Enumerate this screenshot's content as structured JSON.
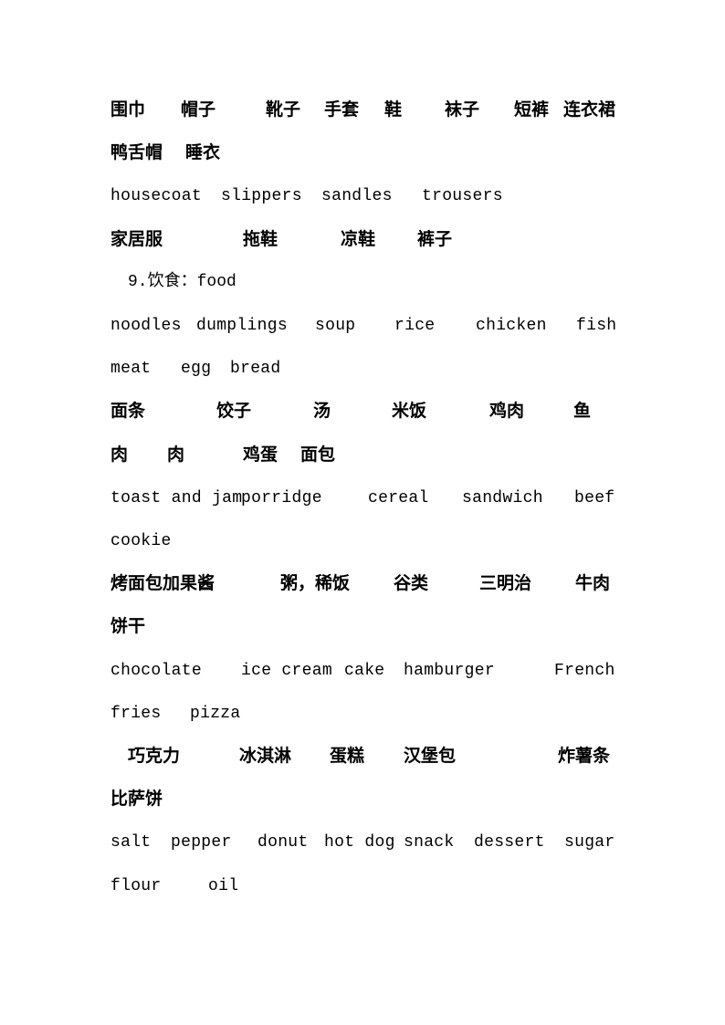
{
  "document": {
    "clothing_cn_row": [
      "围巾",
      "帽子",
      "靴子",
      "手套",
      "鞋",
      "袜子",
      "短裤",
      "连衣裙"
    ],
    "clothing_cn_row2": [
      "鸭舌帽",
      "睡衣"
    ],
    "clothing_en_row3": [
      "housecoat",
      "slippers",
      "sandles",
      "trousers"
    ],
    "clothing_cn_row3": [
      "家居服",
      "拖鞋",
      "凉鞋",
      "裤子"
    ],
    "section_heading": "9.饮食：food",
    "food_en_row1": [
      "noodles",
      "dumplings",
      "soup",
      "rice",
      "chicken",
      "fish"
    ],
    "food_en_row1b": [
      "meat",
      "egg",
      "bread"
    ],
    "food_cn_row1": [
      "面条",
      "饺子",
      "汤",
      "米饭",
      "鸡肉",
      "鱼"
    ],
    "food_cn_row1b": [
      "肉",
      "肉",
      "鸡蛋",
      "面包"
    ],
    "food_en_row2": [
      "toast and jam",
      "porridge",
      "cereal",
      "sandwich",
      "beef"
    ],
    "food_en_row2b": [
      "cookie"
    ],
    "food_cn_row2": [
      "烤面包加果酱",
      "粥，稀饭",
      "谷类",
      "三明治",
      "牛肉"
    ],
    "food_cn_row2b": [
      "饼干"
    ],
    "food_en_row3": [
      "chocolate",
      "ice cream",
      "cake",
      "hamburger",
      "French"
    ],
    "food_en_row3b": [
      "fries",
      "pizza"
    ],
    "food_cn_row3": [
      "巧克力",
      "冰淇淋",
      "蛋糕",
      "汉堡包",
      "炸薯条"
    ],
    "food_cn_row3b": [
      "比萨饼"
    ],
    "food_en_row4": [
      "salt",
      "pepper",
      "donut",
      "hot dog",
      "snack",
      "dessert",
      "sugar"
    ],
    "food_en_row4b": [
      "flour",
      "oil"
    ]
  }
}
